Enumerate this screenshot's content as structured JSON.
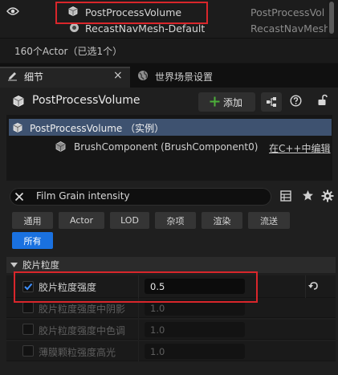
{
  "outliner": {
    "rows": [
      {
        "label": "PostProcessVolume",
        "type": "PostProcessVol"
      },
      {
        "label": "RecastNavMesh-Default",
        "type": "RecastNavMesh"
      }
    ],
    "status": "160个Actor（已选1个）"
  },
  "tabs": {
    "details_label": "细节",
    "close_glyph": "×",
    "world_settings_label": "世界场景设置"
  },
  "details": {
    "actor_name": "PostProcessVolume",
    "add_label": "添加",
    "component_root": "PostProcessVolume （实例）",
    "component_child": "BrushComponent (BrushComponent0)",
    "edit_in_cpp": "在C++中编辑"
  },
  "search": {
    "value": "Film Grain intensity"
  },
  "filters": [
    "通用",
    "Actor",
    "LOD",
    "杂项",
    "渲染",
    "流送"
  ],
  "filter_all": "所有",
  "category": {
    "title": "胶片粒度"
  },
  "properties": [
    {
      "label": "胶片粒度强度",
      "value": "0.5",
      "checked": true
    },
    {
      "label": "胶片粒度强度中阴影",
      "value": "1.0",
      "checked": false
    },
    {
      "label": "胶片粒度强度中色调",
      "value": "1.0",
      "checked": false
    },
    {
      "label": "薄膜颗粒强度高光",
      "value": "1.0",
      "checked": false
    }
  ],
  "colors": {
    "highlight": "#d9262b",
    "accent": "#1a71e0",
    "add_plus": "#4caf3a",
    "selected_row": "#3e5270"
  },
  "icons": [
    "eye-icon",
    "cube-icon",
    "navmesh-icon",
    "pencil-icon",
    "globe-icon",
    "plus-icon",
    "blueprint-icon",
    "help-icon",
    "lock-icon",
    "close-icon",
    "grid-icon",
    "star-icon",
    "gear-icon",
    "caret-down-icon",
    "check-icon",
    "reset-arrow-icon"
  ]
}
